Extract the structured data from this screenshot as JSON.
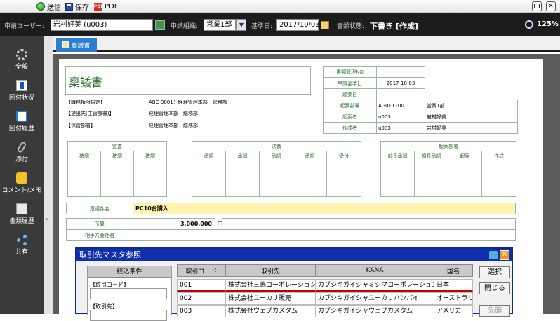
{
  "toolbar": {
    "send_label": "送信",
    "save_label": "保存",
    "pdf_label": "PDF"
  },
  "header": {
    "applicant_label": "申請ユーザー:",
    "applicant_value": "岩村好美 (u003)",
    "org_label": "申請組織:",
    "org_value": "営業1部",
    "date_label": "基準日:",
    "date_value": "2017/10/03",
    "status_label": "書類状態:",
    "status_value": "下書き [作成]",
    "zoom_value": "125%"
  },
  "sidebar": {
    "items": [
      {
        "label": "全般"
      },
      {
        "label": "回付状況"
      },
      {
        "label": "回付履歴"
      },
      {
        "label": "添付"
      },
      {
        "label": "コメント/メモ"
      },
      {
        "label": "書類履歴"
      },
      {
        "label": "共有"
      }
    ]
  },
  "tab": {
    "label": "稟議書"
  },
  "document": {
    "title": "稟議書",
    "left_info": [
      {
        "label": "【職務権限規定】",
        "value": "ABC-0001：経理管理本部　総務部"
      },
      {
        "label": "【提出先(主管部署)】",
        "value": "経理管理本部　総務部"
      },
      {
        "label": "【保管部署】",
        "value": "経理管理本部　総務部"
      }
    ],
    "right_info": {
      "doc_no_label": "書類管理NO",
      "apply_date_label": "申請基準日",
      "apply_date_value": "2017-10-03",
      "draft_date_label": "起案日",
      "dept_label": "起案部署",
      "dept_code": "AG011100",
      "dept_name": "営業1部",
      "drafter_label": "起案者",
      "drafter_code": "u003",
      "drafter_name": "岩村好美",
      "creator_label": "作成者",
      "creator_code": "u003",
      "creator_name": "岩村好美"
    },
    "audit": {
      "title": "監査",
      "cols": [
        "確認",
        "確認",
        "確認"
      ]
    },
    "decision": {
      "title": "決裁",
      "cols": [
        "承認",
        "承認",
        "承認",
        "承認",
        "受付"
      ]
    },
    "drafting": {
      "title": "起案部署",
      "cols": [
        "部長承認",
        "課長承認",
        "起案",
        "作成"
      ]
    },
    "subject_label": "稟議件名",
    "subject_value": "PC10台購入",
    "budget_label": "予算",
    "budget_value": "3,000,000",
    "budget_unit": "円",
    "partner_label": "相手方会社名"
  },
  "dialog": {
    "title": "取引先マスタ参照",
    "filter_header": "絞込条件",
    "filter_code_label": "【取引コード】",
    "filter_name_label": "【取引先】",
    "columns": [
      "取引コード",
      "取引先",
      "KANA",
      "国名"
    ],
    "rows": [
      [
        "001",
        "株式会社三嶋コーポレーション",
        "カブシキガイシャミシマコーポレーション",
        "日本"
      ],
      [
        "002",
        "株式会社ユーカリ販売",
        "カブシキガイシャユーカリハンバイ",
        "オーストラリア"
      ],
      [
        "003",
        "株式会社ウェブカスタム",
        "カブシキガイシャウェブカスタム",
        "アメリカ"
      ]
    ],
    "select_button": "選択",
    "close_button": "閉じる",
    "first_button": "先頭"
  },
  "colors": {
    "header_bg": "#1c1c1c",
    "sidebar_bg": "#3a3a3a",
    "dialog_title_bg": "#0f2fb0",
    "subject_bg": "#fff5b0",
    "selected_row_underline": "#c00000"
  }
}
